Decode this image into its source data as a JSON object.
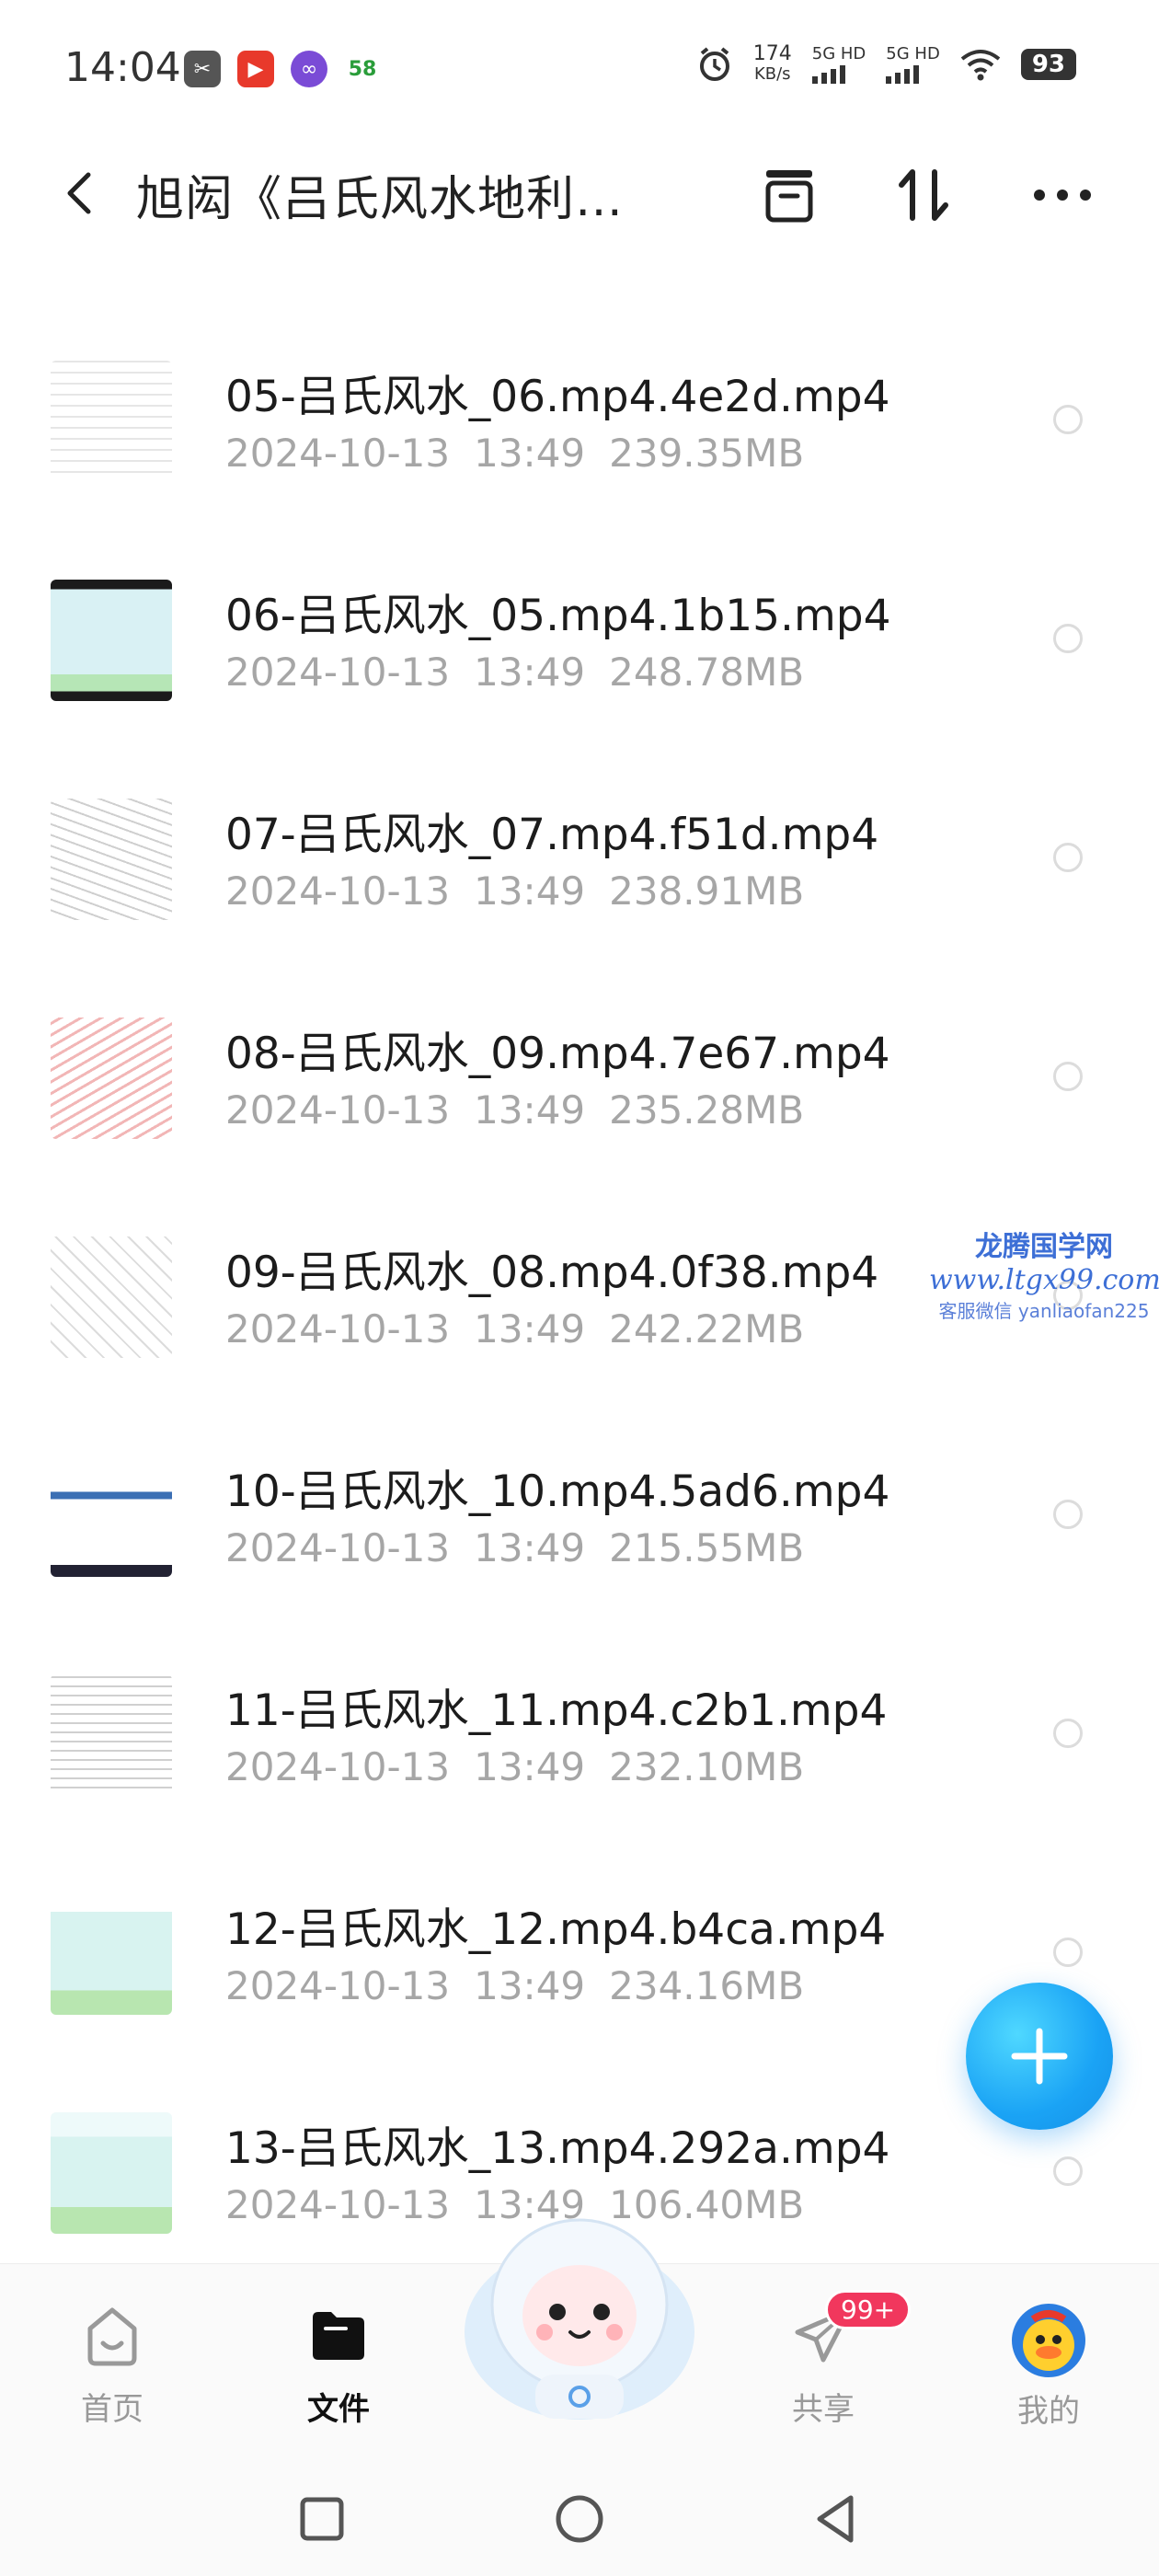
{
  "status_bar": {
    "time": "14:04",
    "notif_badge": "58",
    "net_speed_value": "174",
    "net_speed_unit": "KB/s",
    "sim1": "5G HD",
    "sim2": "5G HD",
    "battery": "93"
  },
  "header": {
    "title": "旭闳《吕氏风水地利…",
    "icons": [
      "back-icon",
      "archive-icon",
      "sort-icon",
      "more-icon"
    ]
  },
  "files": [
    {
      "name": "05-吕氏风水_06.mp4.4e2d.mp4",
      "date": "2024-10-13",
      "time": "13:49",
      "size": "239.35MB"
    },
    {
      "name": "06-吕氏风水_05.mp4.1b15.mp4",
      "date": "2024-10-13",
      "time": "13:49",
      "size": "248.78MB"
    },
    {
      "name": "07-吕氏风水_07.mp4.f51d.mp4",
      "date": "2024-10-13",
      "time": "13:49",
      "size": "238.91MB"
    },
    {
      "name": "08-吕氏风水_09.mp4.7e67.mp4",
      "date": "2024-10-13",
      "time": "13:49",
      "size": "235.28MB"
    },
    {
      "name": "09-吕氏风水_08.mp4.0f38.mp4",
      "date": "2024-10-13",
      "time": "13:49",
      "size": "242.22MB"
    },
    {
      "name": "10-吕氏风水_10.mp4.5ad6.mp4",
      "date": "2024-10-13",
      "time": "13:49",
      "size": "215.55MB"
    },
    {
      "name": "11-吕氏风水_11.mp4.c2b1.mp4",
      "date": "2024-10-13",
      "time": "13:49",
      "size": "232.10MB"
    },
    {
      "name": "12-吕氏风水_12.mp4.b4ca.mp4",
      "date": "2024-10-13",
      "time": "13:49",
      "size": "234.16MB"
    },
    {
      "name": "13-吕氏风水_13.mp4.292a.mp4",
      "date": "2024-10-13",
      "time": "13:49",
      "size": "106.40MB"
    }
  ],
  "watermark": {
    "line1": "龙腾国学网",
    "line2": "www.ltgx99.com",
    "line3": "客服微信 yanliaofan225"
  },
  "bottom_nav": {
    "home": "首页",
    "files": "文件",
    "share": "共享",
    "share_badge": "99+",
    "mine": "我的"
  },
  "colors": {
    "accent_blue": "#1aa3f5",
    "badge_red": "#f1375d",
    "meta_gray": "#a6a6a6"
  }
}
